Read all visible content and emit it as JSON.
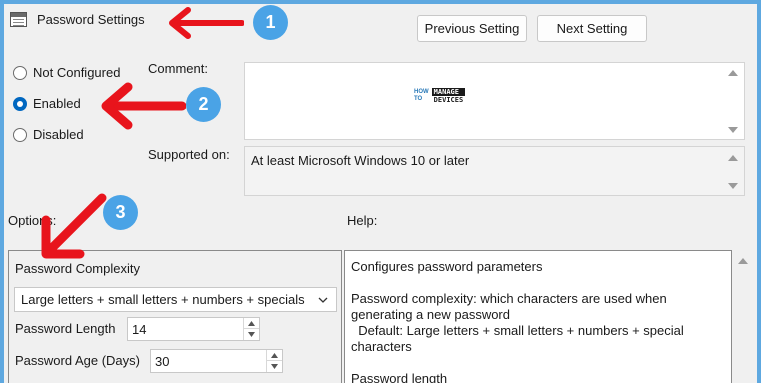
{
  "title": "Password Settings",
  "buttons": {
    "previous": "Previous Setting",
    "next": "Next Setting"
  },
  "state": {
    "options": [
      "Not Configured",
      "Enabled",
      "Disabled"
    ],
    "selected": "Enabled"
  },
  "labels": {
    "comment": "Comment:",
    "supported_on": "Supported on:",
    "options": "Options:",
    "help": "Help:"
  },
  "watermark": {
    "how": "HOW",
    "to": "TO",
    "manage": "MANAGE",
    "devices": "DEVICES"
  },
  "supported_value": "At least Microsoft Windows 10 or later",
  "options_panel": {
    "complexity_label": "Password Complexity",
    "complexity_value": "Large letters + small letters + numbers + specials",
    "length_label": "Password Length",
    "length_value": "14",
    "age_label": "Password Age (Days)",
    "age_value": "30"
  },
  "help_text": {
    "line1": "Configures password parameters",
    "line2": "Password complexity: which characters are used when",
    "line3": "generating a new password",
    "line4": "  Default: Large letters + small letters + numbers + special",
    "line5": "characters",
    "line6": "Password length"
  },
  "annotations": {
    "badge1": "1",
    "badge2": "2",
    "badge3": "3"
  },
  "colors": {
    "frame": "#5ea8e0",
    "arrow": "#e8141c",
    "badge": "#4aa3e6",
    "selected": "#0067c0"
  }
}
